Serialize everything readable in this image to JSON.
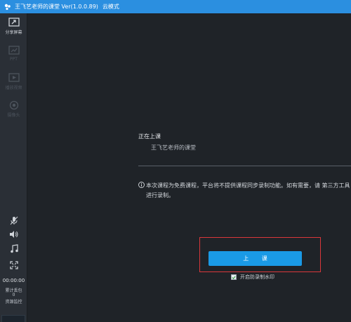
{
  "window": {
    "title": "王飞艺老师的课堂 Ver(1.0.0.89)",
    "mode": "云模式"
  },
  "sidebar": {
    "tools": [
      {
        "label": "分享屏幕",
        "icon": "share-screen-icon",
        "state": "active"
      },
      {
        "label": "PPT",
        "icon": "ppt-icon",
        "state": "disabled"
      },
      {
        "label": "播放视频",
        "icon": "play-video-icon",
        "state": "disabled"
      },
      {
        "label": "摄像头",
        "icon": "camera-icon",
        "state": "disabled"
      }
    ],
    "controls": [
      "microphone-icon",
      "speaker-icon",
      "music-icon",
      "fullscreen-icon"
    ],
    "timer": "00:00:00",
    "stats": {
      "lost_packets_label": "累计丢包",
      "lost_packets_value": "0",
      "resource_monitor_label": "资源监控"
    }
  },
  "main": {
    "status_title": "正在上课",
    "status_subtitle": "王飞艺老师的课堂",
    "notice": "本次课程为免费课程，平台将不提供课程同步录制功能。如有需要，请 第三方工具进行录制。",
    "start_button": "上 课",
    "watermark_option": {
      "label": "开启防录制水印",
      "checked": true
    }
  },
  "colors": {
    "titlebar": "#2b8fe0",
    "sidebar": "#2a2f36",
    "background": "#1f2328",
    "button": "#1a9ae6",
    "highlight": "#d9373b"
  }
}
